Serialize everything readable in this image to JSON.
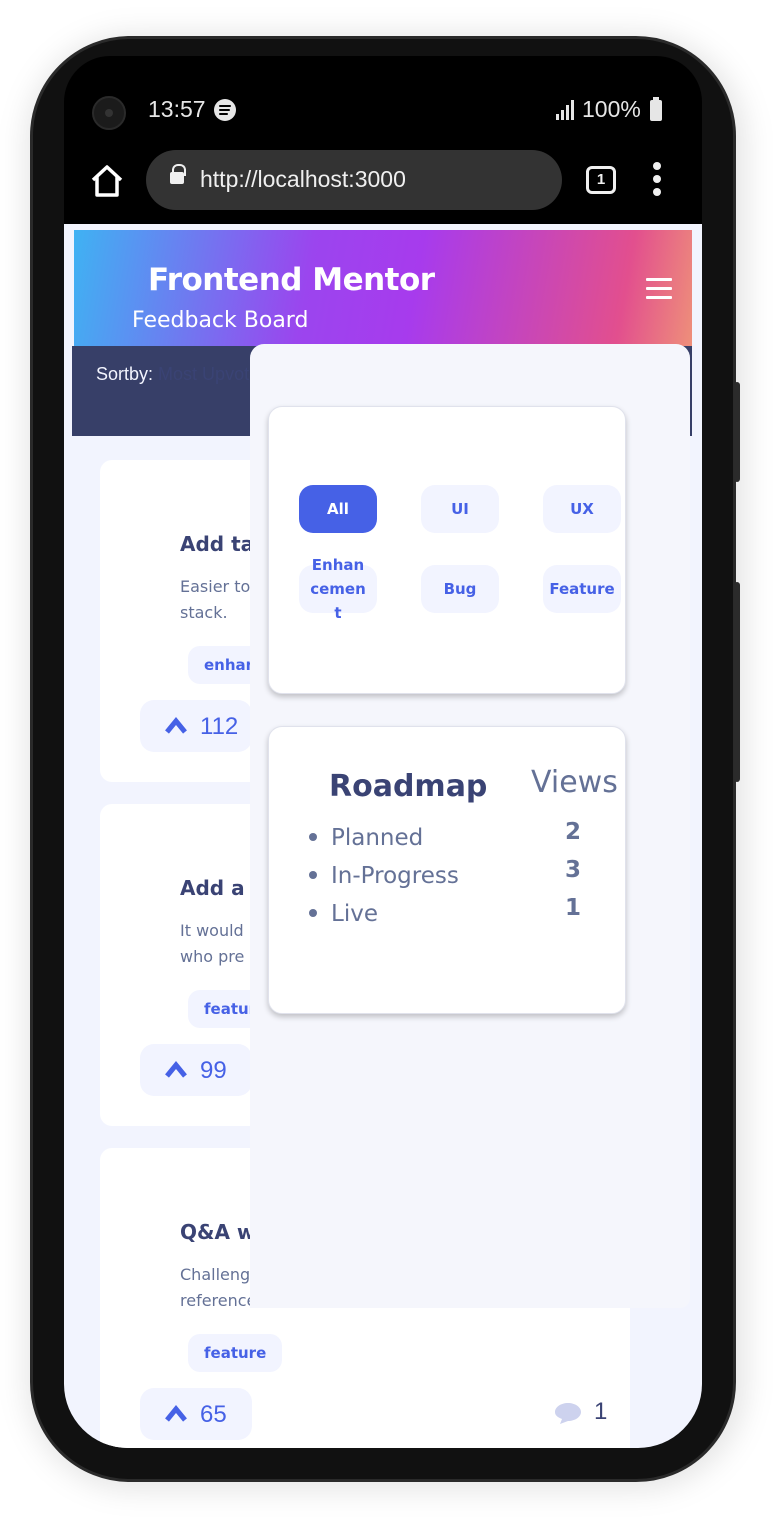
{
  "status_bar": {
    "time": "13:57",
    "battery": "100%"
  },
  "browser": {
    "url": "http://localhost:3000",
    "tab_count": "1"
  },
  "header": {
    "title": "Frontend Mentor",
    "subtitle": "Feedback Board"
  },
  "sort": {
    "label": "Sortby:",
    "value": "Most Upvotes"
  },
  "feedback": [
    {
      "title": "Add ta",
      "description": "Easier to\nstack.",
      "tag": "enhan",
      "upvotes": "112"
    },
    {
      "title": "Add a",
      "description": "It would\nwho pre",
      "tag": "featur",
      "upvotes": "99"
    },
    {
      "title": "Q&A w",
      "description": "Challeng\nreference.",
      "tag": "feature",
      "upvotes": "65",
      "comments": "1"
    }
  ],
  "filters": {
    "chips": [
      "All",
      "UI",
      "UX",
      "Enhancement",
      "Bug",
      "Feature"
    ],
    "active": "All"
  },
  "roadmap": {
    "title": "Roadmap",
    "views_label": "Views",
    "items": [
      {
        "label": "Planned",
        "count": "2"
      },
      {
        "label": "In-Progress",
        "count": "3"
      },
      {
        "label": "Live",
        "count": "1"
      }
    ]
  },
  "colors": {
    "accent": "#4661e6",
    "heading": "#3a4374",
    "body_text": "#647196",
    "sort_bar": "#373f68",
    "page_bg": "#f2f4fe"
  },
  "icons": [
    "camera-icon",
    "spotify-icon",
    "signal-icon",
    "battery-icon",
    "home-icon",
    "lock-icon",
    "tabs-icon",
    "more-vert-icon",
    "hamburger-icon",
    "caret-down-icon",
    "chevron-up-icon",
    "comment-icon"
  ]
}
